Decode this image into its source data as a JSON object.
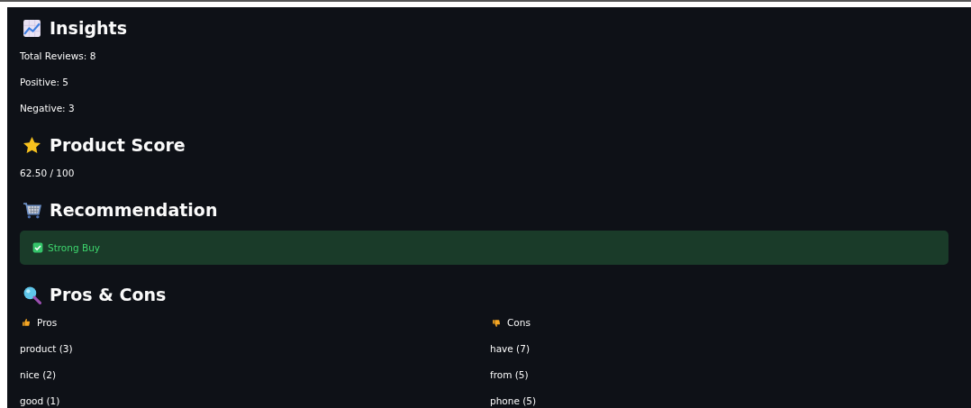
{
  "sections": [
    {
      "kind": "insights",
      "title": "Insights",
      "lines": [
        "Total Reviews: 8",
        "Positive: 5",
        "Negative: 3"
      ]
    },
    {
      "kind": "score",
      "title": "Product Score",
      "lines": [
        "62.50 / 100"
      ]
    },
    {
      "kind": "recommendation",
      "title": "Recommendation",
      "alert": {
        "kind": "success",
        "text": "Strong Buy"
      }
    },
    {
      "kind": "pros_cons",
      "title": "Pros & Cons",
      "columns": [
        {
          "kind": "pros",
          "heading": "Pros",
          "items": [
            "product (3)",
            "nice (2)",
            "good (1)"
          ]
        },
        {
          "kind": "cons",
          "heading": "Cons",
          "items": [
            "have (7)",
            "from (5)",
            "phone (5)"
          ]
        }
      ]
    }
  ]
}
